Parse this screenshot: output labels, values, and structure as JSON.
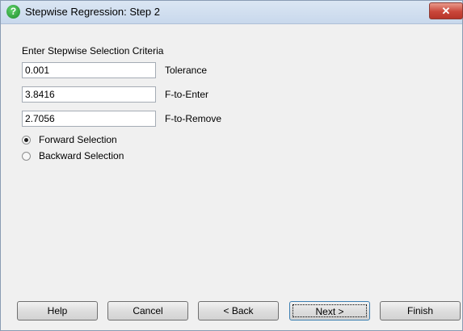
{
  "window": {
    "title": "Stepwise Regression: Step 2",
    "close_glyph": "✕"
  },
  "criteria": {
    "heading": "Enter Stepwise Selection Criteria",
    "fields": [
      {
        "value": "0.001",
        "label": "Tolerance"
      },
      {
        "value": "3.8416",
        "label": "F-to-Enter"
      },
      {
        "value": "2.7056",
        "label": "F-to-Remove"
      }
    ]
  },
  "selection": {
    "options": [
      {
        "label": "Forward Selection",
        "checked": true
      },
      {
        "label": "Backward Selection",
        "checked": false
      }
    ]
  },
  "buttons": {
    "help": "Help",
    "cancel": "Cancel",
    "back": "< Back",
    "next": "Next >",
    "finish": "Finish"
  },
  "icons": {
    "title_icon": "help-question-icon",
    "close_icon": "close-icon"
  }
}
